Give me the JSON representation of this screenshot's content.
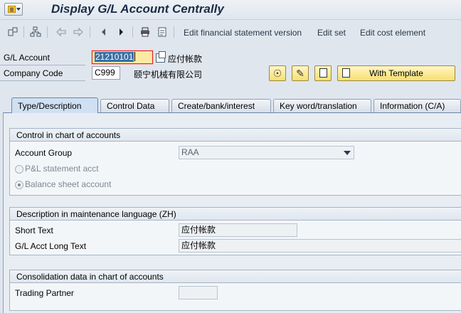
{
  "window": {
    "title": "Display G/L Account Centrally"
  },
  "toolbar": {
    "icons": [
      "other-object-icon",
      "hierarchy-icon",
      "previous-entry-icon",
      "next-entry-icon",
      "first-entry-icon",
      "previous-icon",
      "next-icon",
      "print-icon",
      "notes-icon"
    ],
    "links": [
      "Edit financial statement version",
      "Edit set",
      "Edit cost element"
    ]
  },
  "header": {
    "gl_account_label": "G/L Account",
    "gl_account_value": "21210101",
    "gl_account_desc": "应付帐款",
    "company_code_label": "Company Code",
    "company_code_value": "C999",
    "company_name": "颐宁机械有限公司",
    "with_template_label": "With Template"
  },
  "tabs": [
    {
      "label": "Type/Description",
      "active": true
    },
    {
      "label": "Control Data",
      "active": false
    },
    {
      "label": "Create/bank/interest",
      "active": false
    },
    {
      "label": "Key word/translation",
      "active": false
    },
    {
      "label": "Information (C/A)",
      "active": false
    }
  ],
  "control_group": {
    "title": "Control in chart of accounts",
    "account_group_label": "Account Group",
    "account_group_value": "RAA",
    "pl_label": "P&L statement acct",
    "bs_label": "Balance sheet account",
    "selected_type": "Balance sheet account"
  },
  "description_group": {
    "title": "Description in maintenance language (ZH)",
    "short_text_label": "Short Text",
    "short_text_value": "应付帐款",
    "long_text_label": "G/L Acct Long Text",
    "long_text_value": "应付帐款"
  },
  "consolidation_group": {
    "title": "Consolidation data in chart of accounts",
    "trading_partner_label": "Trading Partner",
    "trading_partner_value": ""
  },
  "colors": {
    "background": "#dfe6ee",
    "title": "#1c2c48",
    "button_yellow": "#f7df70",
    "focused_field": "#fee9a4",
    "active_tab": "#cfe0f2"
  }
}
